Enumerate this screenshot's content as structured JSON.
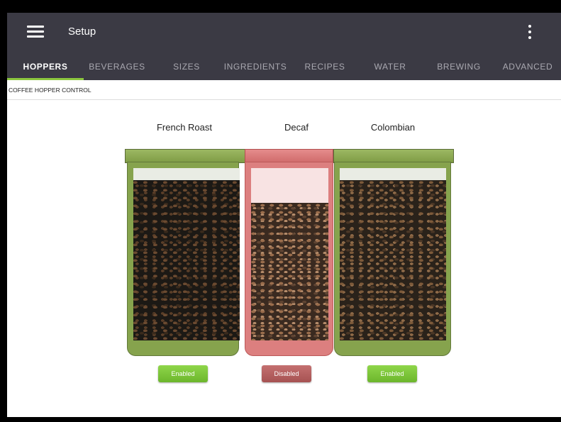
{
  "app": {
    "title": "Setup"
  },
  "tabs": [
    {
      "label": "HOPPERS",
      "active": true
    },
    {
      "label": "BEVERAGES",
      "active": false
    },
    {
      "label": "SIZES",
      "active": false
    },
    {
      "label": "INGREDIENTS",
      "active": false
    },
    {
      "label": "RECIPES",
      "active": false
    },
    {
      "label": "WATER",
      "active": false
    },
    {
      "label": "BREWING",
      "active": false
    },
    {
      "label": "ADVANCED",
      "active": false
    }
  ],
  "section": {
    "title": "COFFEE HOPPER CONTROL"
  },
  "hoppers": [
    {
      "name": "French Roast",
      "status": "Enabled",
      "fill_fraction": 0.93,
      "state_color": "#86a34d"
    },
    {
      "name": "Decaf",
      "status": "Disabled",
      "fill_fraction": 0.8,
      "state_color": "#dc7f7f"
    },
    {
      "name": "Colombian",
      "status": "Enabled",
      "fill_fraction": 0.93,
      "state_color": "#86a34d"
    }
  ],
  "colors": {
    "header": "#3b3a44",
    "accent": "#8cc63f",
    "enabled": "#7bc43a",
    "disabled": "#b85f5f"
  }
}
